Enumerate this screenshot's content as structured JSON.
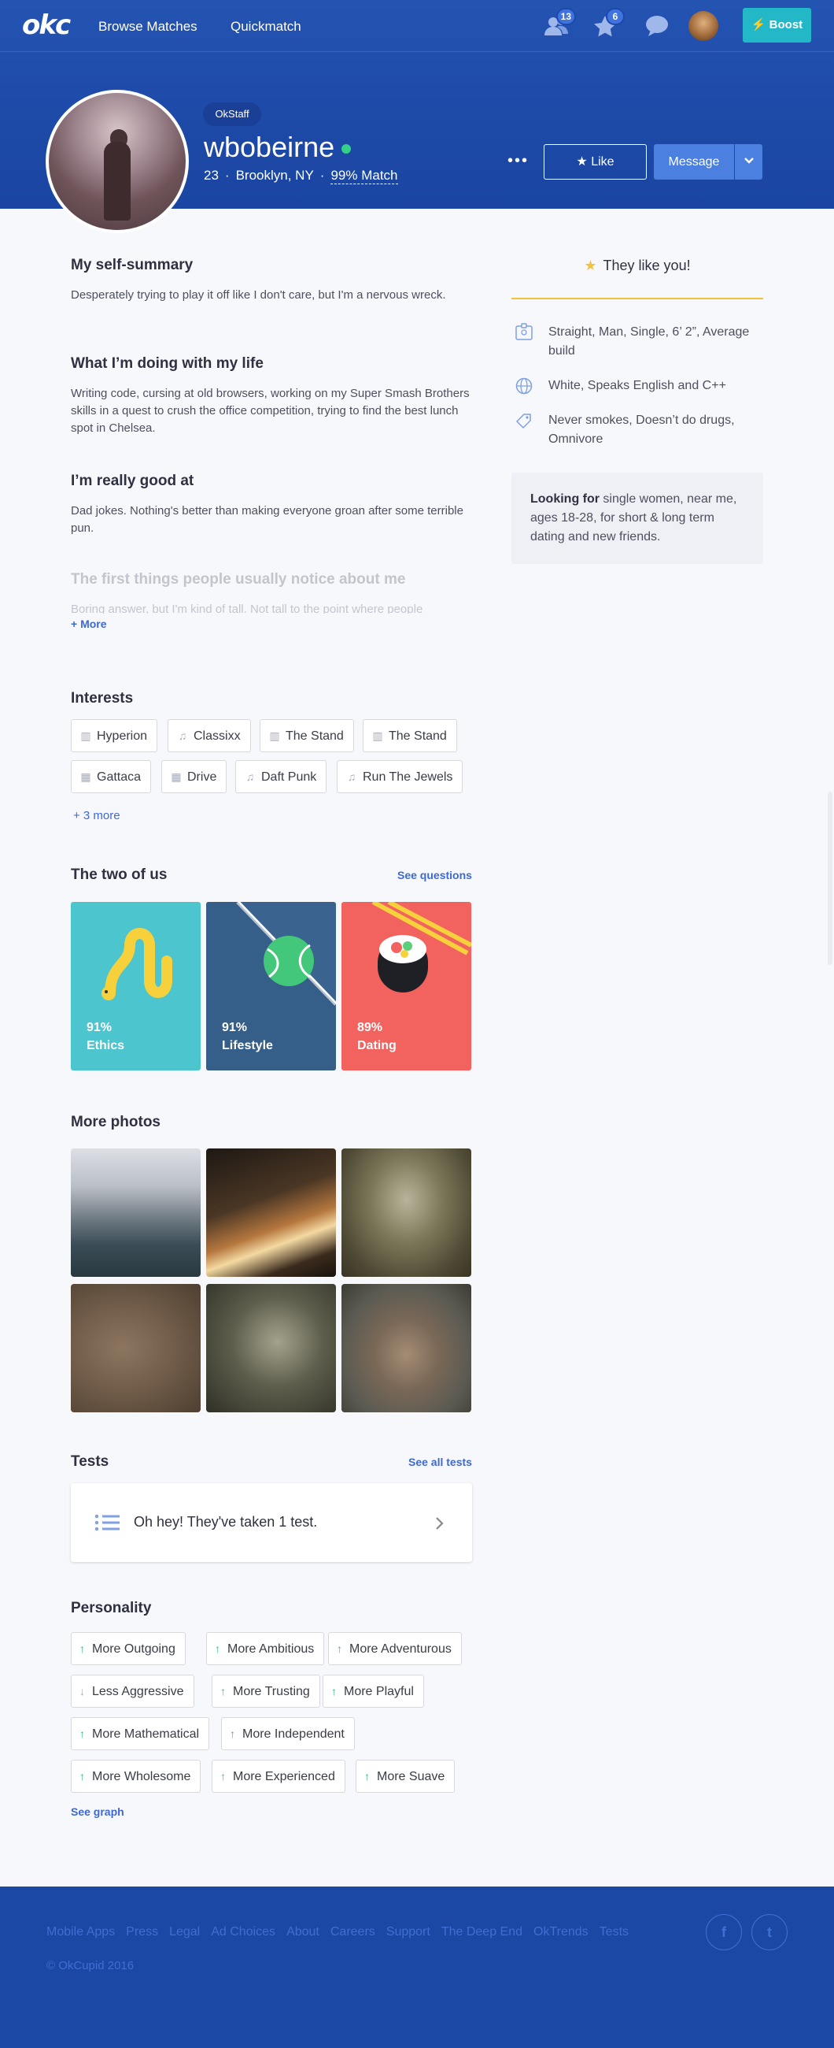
{
  "nav": {
    "logo": "okc",
    "links": [
      "Browse Matches",
      "Quickmatch"
    ],
    "people_badge": "13",
    "stars_badge": "6",
    "boost_label": "Boost"
  },
  "profile": {
    "staff_badge": "OkStaff",
    "username": "wbobeirne",
    "age": "23",
    "location": "Brooklyn, NY",
    "match": "99% Match",
    "like_label": "Like",
    "message_label": "Message",
    "more_dots": "•••"
  },
  "essays": [
    {
      "title": "My self-summary",
      "text": "Desperately trying to play it off like I don't care, but I'm a nervous wreck."
    },
    {
      "title": "What I’m doing with my life",
      "text": "Writing code, cursing at old browsers, working on my Super Smash Brothers skills in a quest to crush the office competition, trying to find the best lunch spot in Chelsea."
    },
    {
      "title": "I’m really good at",
      "text": "Dad jokes. Nothing's better than making everyone groan after some terrible pun."
    },
    {
      "title": "The first things people usually notice about me",
      "text": "Boring answer, but I'm kind of tall. Not tall to the point where people"
    }
  ],
  "more_label": "+ More",
  "interests": {
    "title": "Interests",
    "items": [
      {
        "label": "Hyperion",
        "icon": "book-icon"
      },
      {
        "label": "Classixx",
        "icon": "music-icon"
      },
      {
        "label": "The Stand",
        "icon": "book-icon"
      },
      {
        "label": "The Stand",
        "icon": "book-icon"
      },
      {
        "label": "Gattaca",
        "icon": "film-icon"
      },
      {
        "label": "Drive",
        "icon": "film-icon"
      },
      {
        "label": "Daft Punk",
        "icon": "music-icon"
      },
      {
        "label": "Run The Jewels",
        "icon": "music-icon"
      }
    ],
    "more": "+ 3 more"
  },
  "two_of_us": {
    "title": "The two of us",
    "see_label": "See questions",
    "cards": [
      {
        "pct": "91%",
        "label": "Ethics",
        "color": "#4dc5cf"
      },
      {
        "pct": "91%",
        "label": "Lifestyle",
        "color": "#3a6390"
      },
      {
        "pct": "89%",
        "label": "Dating",
        "color": "#f2625f"
      }
    ]
  },
  "photos": {
    "title": "More photos"
  },
  "tests": {
    "title": "Tests",
    "see_label": "See all tests",
    "text": "Oh hey! They've taken 1 test."
  },
  "personality": {
    "title": "Personality",
    "traits": [
      {
        "label": "More Outgoing",
        "dir": "up"
      },
      {
        "label": "More Ambitious",
        "dir": "up"
      },
      {
        "label": "More Adventurous",
        "dir": "up"
      },
      {
        "label": "Less Aggressive",
        "dir": "down"
      },
      {
        "label": "More Trusting",
        "dir": "up"
      },
      {
        "label": "More Playful",
        "dir": "up"
      },
      {
        "label": "More Mathematical",
        "dir": "up"
      },
      {
        "label": "More Independent",
        "dir": "up"
      },
      {
        "label": "More Wholesome",
        "dir": "up"
      },
      {
        "label": "More Experienced",
        "dir": "up"
      },
      {
        "label": "More Suave",
        "dir": "up"
      }
    ],
    "see_label": "See graph"
  },
  "sidebar": {
    "they_like": "They like you!",
    "details": [
      {
        "icon": "id-card-icon",
        "text": "Straight, Man, Single, 6’ 2”, Average build"
      },
      {
        "icon": "globe-icon",
        "text": "White, Speaks English and C++"
      },
      {
        "icon": "tag-icon",
        "text": "Never smokes, Doesn’t do drugs, Omnivore"
      }
    ],
    "looking_bold": "Looking for",
    "looking_text": " single women, near me, ages 18-28, for short & long term dating and new friends."
  },
  "footer": {
    "links": [
      "Mobile Apps",
      "Press",
      "Legal",
      "Ad Choices",
      "About",
      "Careers",
      "Support",
      "The Deep End",
      "OkTrends",
      "Tests"
    ],
    "copyright": "© OkCupid 2016"
  },
  "colors": {
    "brand": "#1d49a7",
    "accent": "#3d69d4",
    "boost": "#23b8c8",
    "star": "#f5c33b",
    "online": "#35d088"
  }
}
